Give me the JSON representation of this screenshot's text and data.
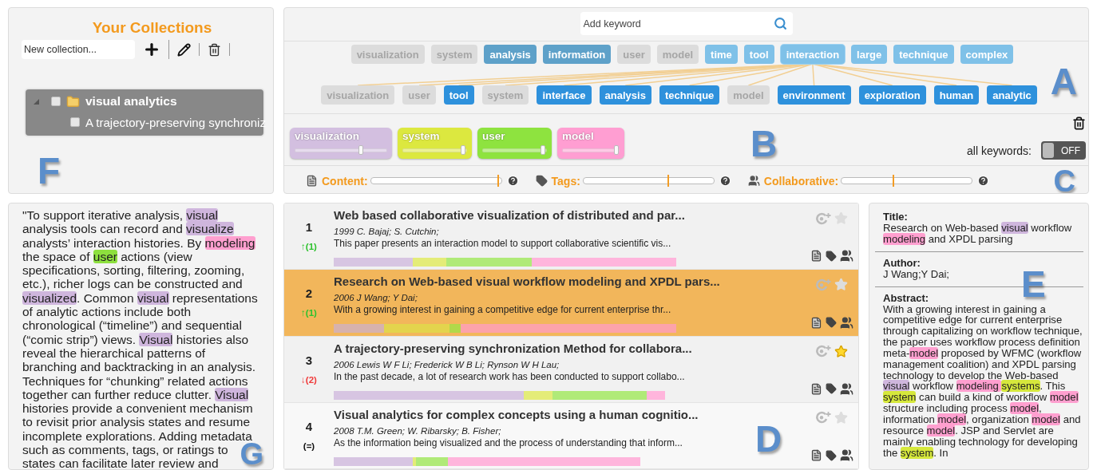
{
  "collections": {
    "title": "Your Collections",
    "input": {
      "placeholder": "New collection..."
    },
    "tree": [
      {
        "label": "visual analytics",
        "expanded": true,
        "checked": false,
        "children": [
          {
            "label": "A trajectory-preserving synchroniz",
            "checked": false
          }
        ]
      }
    ],
    "panel_label": "F"
  },
  "keywords": {
    "search": {
      "placeholder": "Add keyword"
    },
    "row_1": [
      {
        "label": "visualization",
        "kind": "muted",
        "expanded": false
      },
      {
        "label": "system",
        "kind": "muted",
        "expanded": false
      },
      {
        "label": "analysis",
        "kind": "dark",
        "expanded": false
      },
      {
        "label": "information",
        "kind": "dark",
        "expanded": false
      },
      {
        "label": "user",
        "kind": "muted",
        "expanded": false
      },
      {
        "label": "model",
        "kind": "muted",
        "expanded": false
      },
      {
        "label": "time",
        "kind": "light",
        "expanded": false
      },
      {
        "label": "tool",
        "kind": "light",
        "expanded": false
      },
      {
        "label": "interaction",
        "kind": "light",
        "expanded": true
      },
      {
        "label": "large",
        "kind": "light",
        "expanded": false
      },
      {
        "label": "technique",
        "kind": "light",
        "expanded": false
      },
      {
        "label": "complex",
        "kind": "light",
        "expanded": false
      }
    ],
    "row_2": [
      {
        "label": "visualization",
        "kind": "muted",
        "linked": true
      },
      {
        "label": "user",
        "kind": "muted",
        "linked": true
      },
      {
        "label": "tool",
        "kind": "strong",
        "linked": true
      },
      {
        "label": "system",
        "kind": "muted",
        "linked": true
      },
      {
        "label": "interface",
        "kind": "strong",
        "linked": true
      },
      {
        "label": "analysis",
        "kind": "strong",
        "linked": true
      },
      {
        "label": "technique",
        "kind": "strong",
        "linked": true
      },
      {
        "label": "model",
        "kind": "muted",
        "linked": true
      },
      {
        "label": "environment",
        "kind": "strong",
        "linked": true
      },
      {
        "label": "exploration",
        "kind": "strong",
        "linked": true
      },
      {
        "label": "human",
        "kind": "strong",
        "linked": true
      },
      {
        "label": "analytic",
        "kind": "strong",
        "linked": true
      }
    ],
    "panel_label": "A"
  },
  "filters": {
    "items": [
      {
        "label": "visualization",
        "color": "#d3bfe0",
        "level": 0.72
      },
      {
        "label": "system",
        "color": "#dce83f",
        "level": 0.95
      },
      {
        "label": "user",
        "color": "#8ee33f",
        "level": 0.95
      },
      {
        "label": "model",
        "color": "#ff9ed2",
        "level": 0.95
      }
    ],
    "toggle": {
      "label": "all keywords:",
      "on": false,
      "text": "OFF"
    },
    "panel_label": "B"
  },
  "weights": {
    "items": [
      {
        "kind": "content",
        "label": "Content:",
        "level": 0.98
      },
      {
        "kind": "tags",
        "label": "Tags:",
        "level": 0.65
      },
      {
        "kind": "collaborative",
        "label": "Collaborative:",
        "level": 0.4
      }
    ],
    "panel_label": "C"
  },
  "passage": {
    "segments": [
      {
        "text": "\"To support iterative analysis, "
      },
      {
        "text": "visual",
        "color": "#cfb6dd"
      },
      {
        "text": " analysis tools can record and "
      },
      {
        "text": "visualize",
        "color": "#cfb6dd"
      },
      {
        "text": " analysts’ interaction histories. By "
      },
      {
        "text": "modeling",
        "color": "#ff9fcf"
      },
      {
        "text": " the space of "
      },
      {
        "text": "user",
        "color": "#8de03e"
      },
      {
        "text": " actions (view specifications, sorting, filtering, zooming, etc.), richer logs can be constructed and "
      },
      {
        "text": "visualized",
        "color": "#cfb6dd"
      },
      {
        "text": ". Common "
      },
      {
        "text": "visual",
        "color": "#cfb6dd"
      },
      {
        "text": " representations of analytic actions include both chronological (“timeline”) and sequential (“comic strip”) views. "
      },
      {
        "text": "Visual",
        "color": "#cfb6dd"
      },
      {
        "text": " histories also reveal the hierarchical patterns of branching and backtracking in an analysis. Techniques for “chunking” related actions together can further reduce clutter. "
      },
      {
        "text": "Visual",
        "color": "#cfb6dd"
      },
      {
        "text": " histories provide a convenient mechanism to revisit prior analysis states and resume incomplete explorations. Adding metadata such as comments, tags, or ratings to states can facilitate later review and"
      }
    ],
    "panel_label": "G"
  },
  "results": {
    "rows": [
      {
        "rank": "1",
        "change": "↑(1)",
        "kind": "up",
        "title": "Web based collaborative visualization of distributed and par...",
        "meta": "1999 C. Bajaj; S. Cutchin;",
        "snippet": "This paper presents an interaction model to support collaborative scientific vis...",
        "selected": false,
        "starred": false,
        "segments": [
          {
            "color": "#d7c5e2"
          },
          {
            "color": "#e4ec78"
          },
          {
            "color": "#b0ea78"
          },
          {
            "color": "#ffb5dc"
          }
        ]
      },
      {
        "rank": "2",
        "change": "↑(1)",
        "kind": "up",
        "title": "Research on Web-based visual workflow modeling and XPDL pars...",
        "meta": "2006 J Wang; Y Dai;",
        "snippet": "With a growing interest in gaining a competitive edge for current enterprise thr...",
        "selected": true,
        "starred": false,
        "segments": [
          {
            "color": "#d7b2ad"
          },
          {
            "color": "#e3d44d"
          },
          {
            "color": "#b1d94a"
          },
          {
            "color": "#fca3aa"
          }
        ]
      },
      {
        "rank": "3",
        "change": "↓(2)",
        "kind": "down",
        "title": "A trajectory-preserving synchronization Method for collabora...",
        "meta": "2006 Lewis W F Li; Frederick W B Li; Rynson W H Lau;",
        "snippet": "In the past decade, a lot of research work has been conducted to support collabo...",
        "selected": false,
        "starred": true,
        "segments": [
          {
            "color": "#d7c5e2"
          },
          {
            "color": "#e4ec78"
          },
          {
            "color": "#b0ea78"
          },
          {
            "color": "#ffb5dc"
          }
        ]
      },
      {
        "rank": "4",
        "change": "(=)",
        "kind": "same",
        "title": "Visual analytics for complex concepts using a human cognitio...",
        "meta": "2008 T.M. Green; W. Ribarsky; B. Fisher;",
        "snippet": "As the information being visualized and the process of understanding that inform...",
        "selected": false,
        "starred": false,
        "segments": [
          {
            "color": "#d7c5e2"
          },
          {
            "color": "#e4ec78"
          },
          {
            "color": "#b0ea78"
          },
          {
            "color": "#ffb5dc"
          }
        ]
      }
    ],
    "panel_label": "D"
  },
  "details": {
    "title_label": "Title:",
    "title": [
      {
        "text": "Research on Web-based "
      },
      {
        "text": "visual",
        "color": "#cfb6dd"
      },
      {
        "text": " workflow "
      },
      {
        "text": "modeling",
        "color": "#ff9fcf"
      },
      {
        "text": " and XPDL parsing"
      }
    ],
    "author_label": "Author:",
    "author": "J Wang;Y Dai;",
    "abstract_label": "Abstract:",
    "abstract": [
      {
        "text": "With a growing interest in gaining a competitive edge for current enterprise through capitalizing on workflow technique, the paper uses workflow process definition meta-"
      },
      {
        "text": "model",
        "color": "#ff9fcf"
      },
      {
        "text": " proposed by WFMC (workflow management coalition) and XPDL parsing technology to develop the Web-based "
      },
      {
        "text": "visual",
        "color": "#cfb6dd"
      },
      {
        "text": " workflow "
      },
      {
        "text": "modeling ",
        "color": "#ff9fcf"
      },
      {
        "text": "systems",
        "color": "#d6e83c"
      },
      {
        "text": ". This "
      },
      {
        "text": "system",
        "color": "#d6e83c"
      },
      {
        "text": " can build a kind of workflow "
      },
      {
        "text": "model",
        "color": "#ff9fcf"
      },
      {
        "text": " structure including process "
      },
      {
        "text": "model",
        "color": "#ff9fcf"
      },
      {
        "text": ", information "
      },
      {
        "text": "model",
        "color": "#ff9fcf"
      },
      {
        "text": ", organization "
      },
      {
        "text": "model",
        "color": "#ff9fcf"
      },
      {
        "text": " and resource "
      },
      {
        "text": "model",
        "color": "#ff9fcf"
      },
      {
        "text": ". JSP and Servlet are mainly enabling technology for developing the "
      },
      {
        "text": "system",
        "color": "#d6e83c"
      },
      {
        "text": ". In"
      }
    ],
    "panel_label": "E"
  }
}
